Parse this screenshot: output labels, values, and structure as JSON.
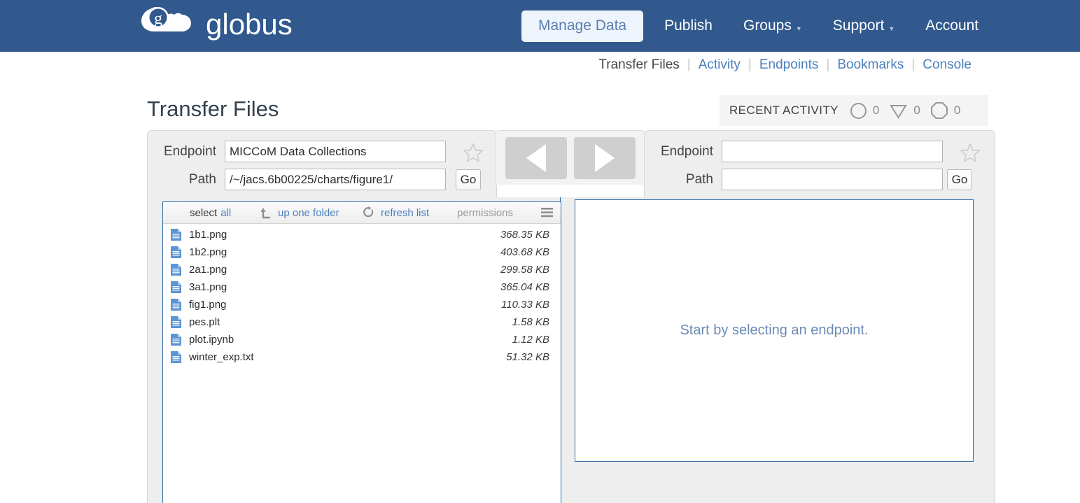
{
  "brand": {
    "name": "globus",
    "logo_icon": "globus-cloud-g-icon",
    "nav_bg": "#31598e",
    "link_blue": "#4a7fbd",
    "panel_border_blue": "#2f6ba5"
  },
  "topnav": {
    "items": [
      {
        "label": "Manage Data",
        "active": true,
        "caret": false
      },
      {
        "label": "Publish",
        "active": false,
        "caret": false
      },
      {
        "label": "Groups",
        "active": false,
        "caret": true
      },
      {
        "label": "Support",
        "active": false,
        "caret": true
      },
      {
        "label": "Account",
        "active": false,
        "caret": false
      }
    ]
  },
  "subnav": {
    "items": [
      {
        "label": "Transfer Files",
        "active": true
      },
      {
        "label": "Activity",
        "active": false
      },
      {
        "label": "Endpoints",
        "active": false
      },
      {
        "label": "Bookmarks",
        "active": false
      },
      {
        "label": "Console",
        "active": false
      }
    ],
    "separator": "|"
  },
  "page": {
    "title": "Transfer Files"
  },
  "recent_activity": {
    "label": "RECENT ACTIVITY",
    "items": [
      {
        "icon": "circle-icon",
        "count": "0"
      },
      {
        "icon": "triangle-down-icon",
        "count": "0"
      },
      {
        "icon": "octagon-icon",
        "count": "0"
      }
    ]
  },
  "left_panel": {
    "endpoint_label": "Endpoint",
    "endpoint_value": "MICCoM Data Collections",
    "endpoint_placeholder": "",
    "path_label": "Path",
    "path_value": "/~/jacs.6b00225/charts/figure1/",
    "path_placeholder": "",
    "go_label": "Go",
    "bookmark_icon": "star-icon",
    "toolbar": {
      "select_label": "select",
      "select_all_label": "all",
      "up_one_folder_label": "up one folder",
      "up_one_folder_icon": "arrow-up-left-icon",
      "refresh_label": "refresh list",
      "refresh_icon": "refresh-icon",
      "permissions_label": "permissions",
      "menu_icon": "hamburger-menu-icon"
    },
    "files": [
      {
        "name": "1b1.png",
        "size": "368.35 KB",
        "icon": "file-icon"
      },
      {
        "name": "1b2.png",
        "size": "403.68 KB",
        "icon": "file-icon"
      },
      {
        "name": "2a1.png",
        "size": "299.58 KB",
        "icon": "file-icon"
      },
      {
        "name": "3a1.png",
        "size": "365.04 KB",
        "icon": "file-icon"
      },
      {
        "name": "fig1.png",
        "size": "110.33 KB",
        "icon": "file-icon"
      },
      {
        "name": "pes.plt",
        "size": "1.58 KB",
        "icon": "file-icon"
      },
      {
        "name": "plot.ipynb",
        "size": "1.12 KB",
        "icon": "file-icon"
      },
      {
        "name": "winter_exp.txt",
        "size": "51.32 KB",
        "icon": "file-icon"
      }
    ]
  },
  "transfer_controls": {
    "left_arrow_icon": "arrow-left-icon",
    "right_arrow_icon": "arrow-right-icon",
    "enabled": false
  },
  "right_panel": {
    "endpoint_label": "Endpoint",
    "endpoint_value": "",
    "endpoint_placeholder": "",
    "path_label": "Path",
    "path_value": "",
    "path_placeholder": "",
    "go_label": "Go",
    "bookmark_icon": "star-icon",
    "empty_message": "Start by selecting an endpoint."
  }
}
